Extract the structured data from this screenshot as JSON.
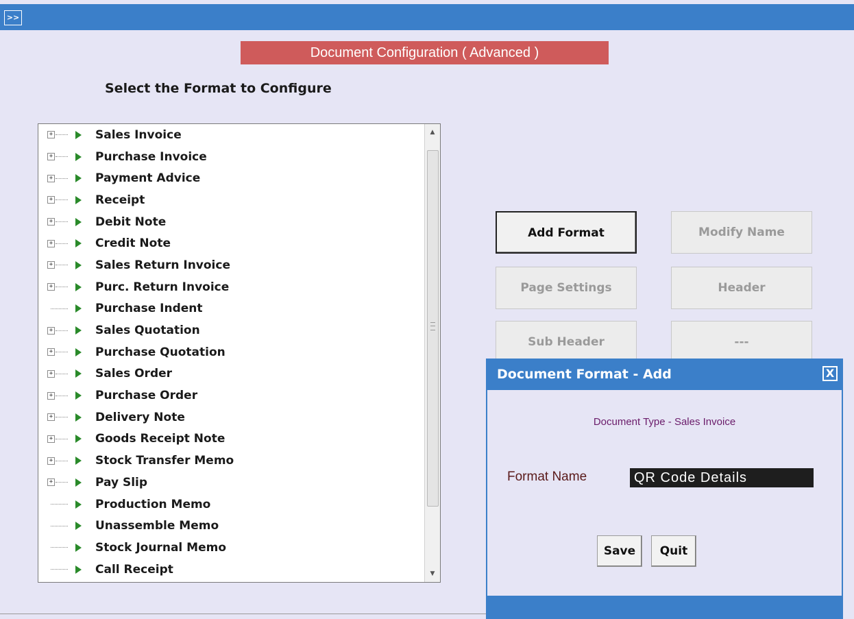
{
  "topbar": {
    "expand_label": ">>"
  },
  "title": "Document Configuration ( Advanced )",
  "select_heading": "Select the Format to Configure",
  "tree_items": [
    {
      "label": "Sales Invoice",
      "expandable": true
    },
    {
      "label": "Purchase Invoice",
      "expandable": true
    },
    {
      "label": "Payment Advice",
      "expandable": true
    },
    {
      "label": "Receipt",
      "expandable": true
    },
    {
      "label": "Debit Note",
      "expandable": true
    },
    {
      "label": "Credit Note",
      "expandable": true
    },
    {
      "label": "Sales Return Invoice",
      "expandable": true
    },
    {
      "label": "Purc. Return Invoice",
      "expandable": true
    },
    {
      "label": "Purchase Indent",
      "expandable": false
    },
    {
      "label": "Sales Quotation",
      "expandable": true
    },
    {
      "label": "Purchase Quotation",
      "expandable": true
    },
    {
      "label": "Sales Order",
      "expandable": true
    },
    {
      "label": "Purchase Order",
      "expandable": true
    },
    {
      "label": "Delivery Note",
      "expandable": true
    },
    {
      "label": "Goods Receipt Note",
      "expandable": true
    },
    {
      "label": "Stock Transfer Memo",
      "expandable": true
    },
    {
      "label": "Pay Slip",
      "expandable": true
    },
    {
      "label": "Production Memo",
      "expandable": false
    },
    {
      "label": "Unassemble Memo",
      "expandable": false
    },
    {
      "label": "Stock Journal Memo",
      "expandable": false
    },
    {
      "label": "Call Receipt",
      "expandable": false
    }
  ],
  "buttons": {
    "add_format": "Add Format",
    "modify_name": "Modify Name",
    "page_settings": "Page Settings",
    "header": "Header",
    "sub_header": "Sub Header",
    "blank": "---"
  },
  "dialog": {
    "title": "Document Format - Add",
    "close": "X",
    "doc_type": "Document Type - Sales Invoice",
    "format_name_label": "Format Name",
    "format_name_value": "QR Code Details",
    "save": "Save",
    "quit": "Quit"
  },
  "colors": {
    "accent_blue": "#3b7fc9",
    "title_red": "#cf5b5b",
    "background": "#e6e5f5"
  },
  "icons": {
    "expand": "plus-box-icon",
    "item": "green-triangle-arrow-icon"
  }
}
